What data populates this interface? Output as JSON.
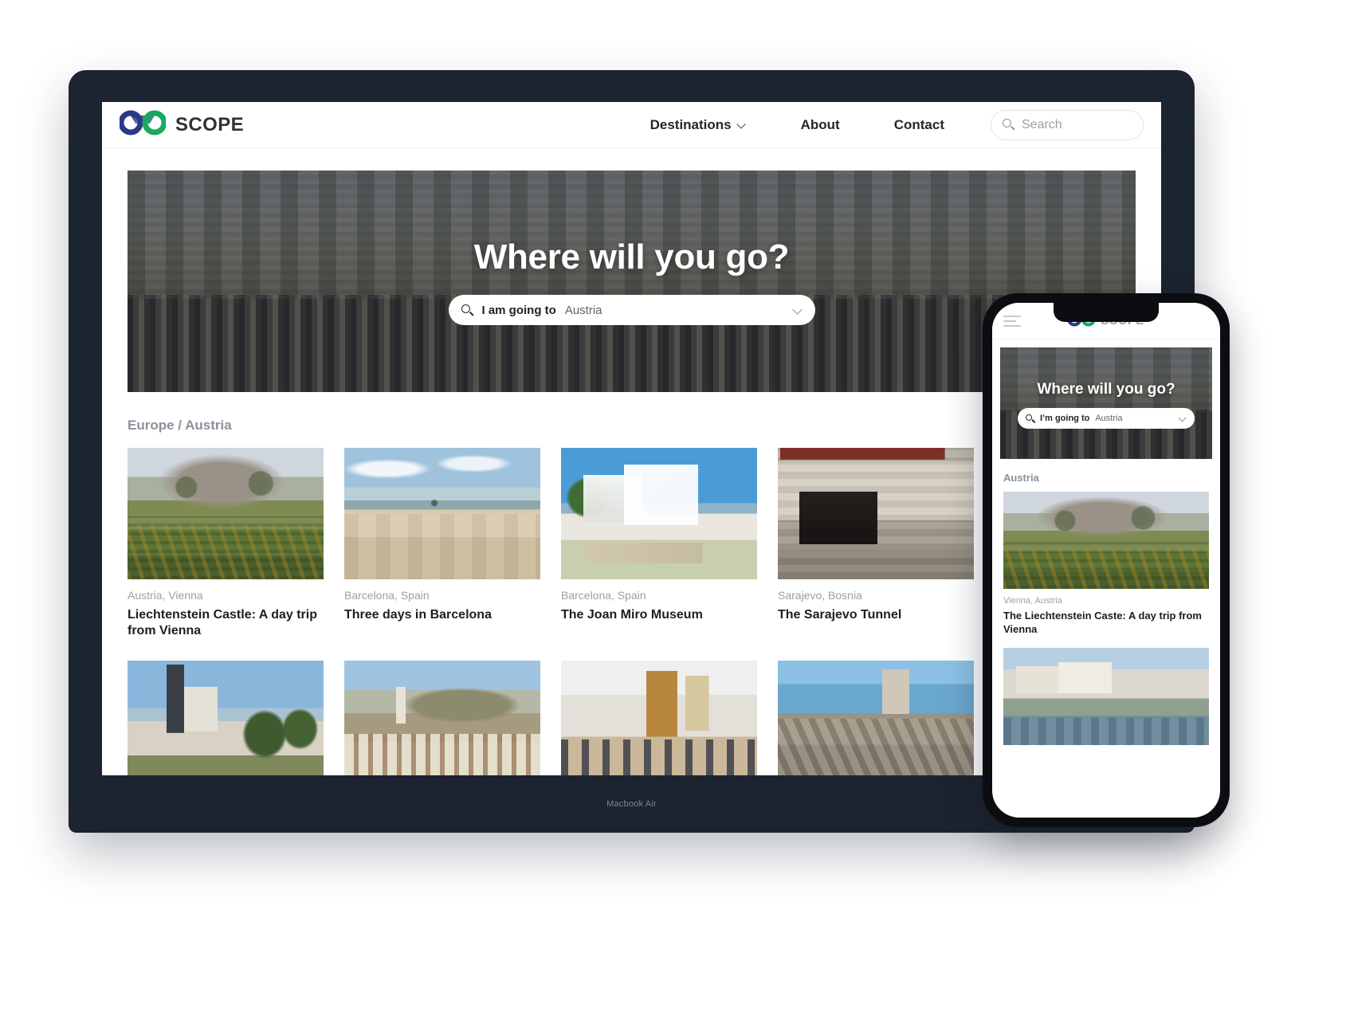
{
  "brand": {
    "name": "SCOPE",
    "logo_icon": "binoculars-logo-icon",
    "blue": "#2b3a87",
    "green": "#17a95e"
  },
  "desktop": {
    "nav": [
      {
        "label": "Destinations",
        "has_dropdown": true
      },
      {
        "label": "About",
        "has_dropdown": false
      },
      {
        "label": "Contact",
        "has_dropdown": false
      }
    ],
    "search": {
      "placeholder": "Search",
      "value": "",
      "icon": "search-icon"
    },
    "hero": {
      "title": "Where will you go?",
      "search_label": "I am going to",
      "search_value": "Austria",
      "search_icon": "search-icon",
      "dropdown_icon": "chevron-down-icon",
      "image": "crowded-street-crossing"
    },
    "breadcrumb": "Europe / Austria",
    "cards": [
      {
        "meta": "Austria, Vienna",
        "title": "Liechtenstein Castle: A day trip from Vienna",
        "image": "castle-on-hill"
      },
      {
        "meta": "Barcelona, Spain",
        "title": "Three days in Barcelona",
        "image": "beach-with-palms"
      },
      {
        "meta": "Barcelona, Spain",
        "title": "The Joan Miro Museum",
        "image": "white-museum-building"
      },
      {
        "meta": "Sarajevo, Bosnia",
        "title": "The Sarajevo Tunnel",
        "image": "tunnel-house-entrance"
      },
      {
        "meta": "",
        "title": "",
        "image": "church-with-statue"
      },
      {
        "meta": "",
        "title": "",
        "image": "old-town-hillside"
      },
      {
        "meta": "",
        "title": "",
        "image": "gallery-interior"
      },
      {
        "meta": "",
        "title": "",
        "image": "rocky-coastline"
      }
    ],
    "device_label": "Macbook Air"
  },
  "phone": {
    "menu_icon": "hamburger-menu-icon",
    "brand_name": "SCOPE",
    "hero": {
      "title": "Where will you go?",
      "search_label": "I’m going to",
      "search_value": "Austria",
      "search_icon": "search-icon",
      "dropdown_icon": "chevron-down-icon",
      "image": "crowded-street-crossing"
    },
    "section_title": "Austria",
    "cards": [
      {
        "meta": "Vienna, Austria",
        "title": "The Liechtenstein Caste: A day trip from Vienna",
        "image": "castle-on-hill"
      },
      {
        "meta": "",
        "title": "",
        "image": "river-city-embankment"
      }
    ]
  }
}
